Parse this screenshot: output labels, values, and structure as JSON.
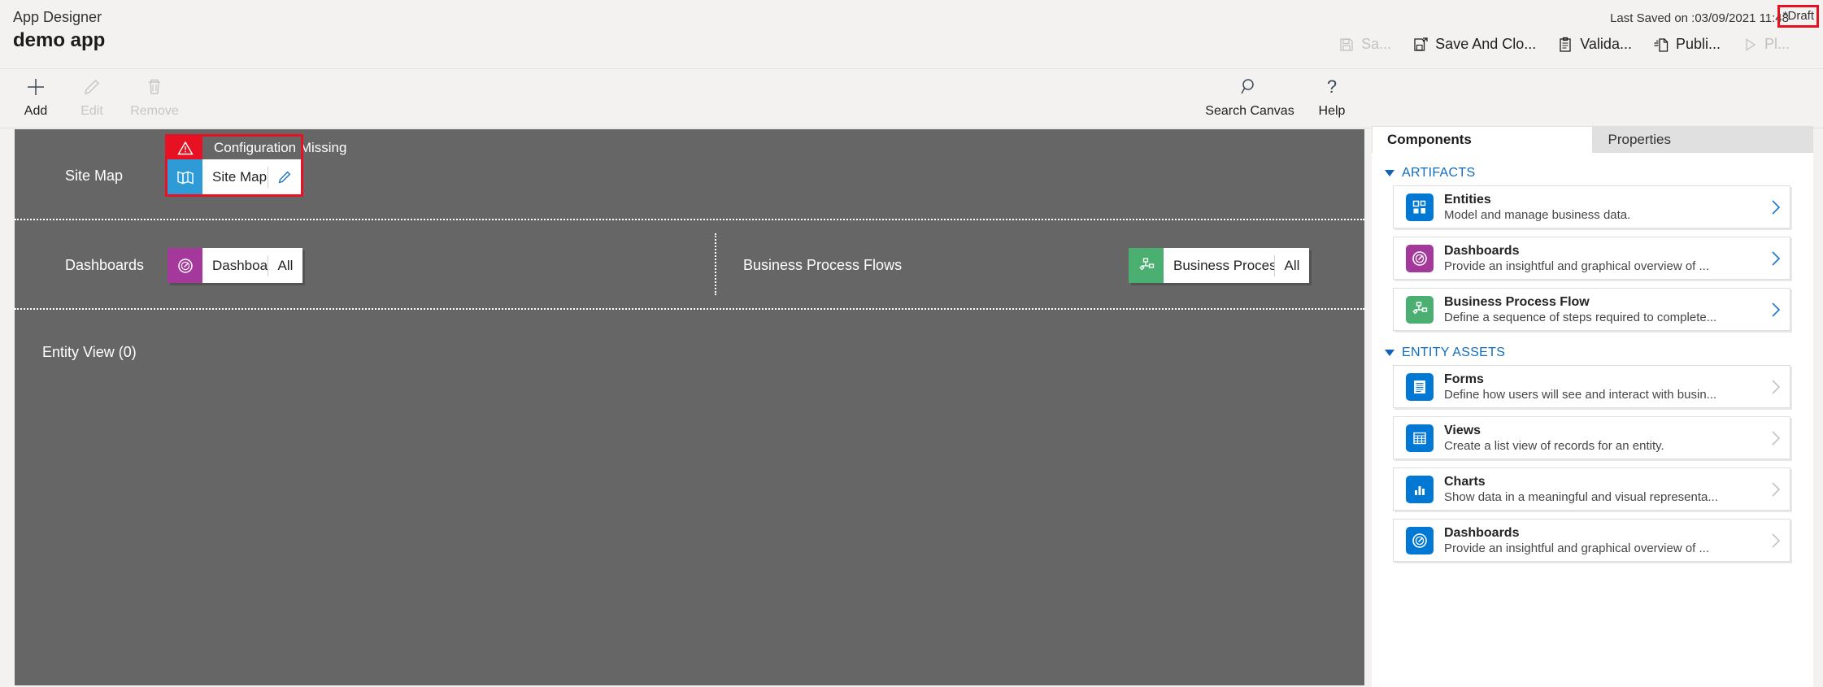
{
  "header": {
    "app_designer_label": "App Designer",
    "app_name": "demo app",
    "last_saved": "Last Saved on :03/09/2021 11:48",
    "draft_badge": "*Draft",
    "accent_red": "#e81123",
    "actions": [
      {
        "label": "Sa...",
        "icon": "save-icon",
        "disabled": true
      },
      {
        "label": "Save And Clo...",
        "icon": "save-and-close-icon",
        "disabled": false
      },
      {
        "label": "Valida...",
        "icon": "validate-clipboard-icon",
        "disabled": false
      },
      {
        "label": "Publi...",
        "icon": "publish-icon",
        "disabled": false
      },
      {
        "label": "Pl...",
        "icon": "play-icon",
        "disabled": true
      }
    ]
  },
  "commandbar": {
    "left": [
      {
        "label": "Add",
        "icon": "plus-icon",
        "disabled": false
      },
      {
        "label": "Edit",
        "icon": "pencil-icon",
        "disabled": true
      },
      {
        "label": "Remove",
        "icon": "trash-icon",
        "disabled": true
      }
    ],
    "right": [
      {
        "label": "Search Canvas",
        "icon": "search-icon",
        "disabled": false
      },
      {
        "label": "Help",
        "icon": "question-mark-icon",
        "disabled": false
      }
    ]
  },
  "canvas": {
    "rows": [
      {
        "label": "Site Map",
        "warning": {
          "text": "Configuration Missing",
          "icon": "warning-triangle-icon",
          "color": "#e81123"
        },
        "tiles": [
          {
            "name": "Site Map",
            "icon": "sitemap-book-icon",
            "icon_color": "#2e9bd6",
            "suffix": "",
            "has_edit": true,
            "highlighted": true
          }
        ]
      },
      {
        "label": "Dashboards",
        "tiles": [
          {
            "name": "Dashboards",
            "icon": "dashboard-gauge-icon",
            "icon_color": "#a4399b",
            "suffix": "All",
            "has_edit": false,
            "highlighted": false
          }
        ]
      },
      {
        "label": "Business Process Flows",
        "tiles": [
          {
            "name": "Business Proces...",
            "icon": "process-flow-icon",
            "icon_color": "#4caf72",
            "suffix": "All",
            "has_edit": false,
            "highlighted": false
          }
        ]
      },
      {
        "label": "Entity View (0)",
        "tiles": []
      }
    ]
  },
  "panel": {
    "tabs": [
      {
        "label": "Components",
        "active": true
      },
      {
        "label": "Properties",
        "active": false
      }
    ],
    "groups": [
      {
        "title": "ARTIFACTS",
        "cards": [
          {
            "title": "Entities",
            "desc": "Model and manage business data.",
            "icon": "entities-grid-icon",
            "color": "#0078d4",
            "chevron_enabled": true
          },
          {
            "title": "Dashboards",
            "desc": "Provide an insightful and graphical overview of ...",
            "icon": "dashboard-gauge-icon",
            "color": "#a4399b",
            "chevron_enabled": true
          },
          {
            "title": "Business Process Flow",
            "desc": "Define a sequence of steps required to complete...",
            "icon": "process-flow-icon",
            "color": "#4caf72",
            "chevron_enabled": true
          }
        ]
      },
      {
        "title": "ENTITY ASSETS",
        "cards": [
          {
            "title": "Forms",
            "desc": "Define how users will see and interact with busin...",
            "icon": "form-icon",
            "color": "#0078d4",
            "chevron_enabled": false
          },
          {
            "title": "Views",
            "desc": "Create a list view of records for an entity.",
            "icon": "views-table-icon",
            "color": "#0078d4",
            "chevron_enabled": false
          },
          {
            "title": "Charts",
            "desc": "Show data in a meaningful and visual representa...",
            "icon": "charts-bar-icon",
            "color": "#0078d4",
            "chevron_enabled": false
          },
          {
            "title": "Dashboards",
            "desc": "Provide an insightful and graphical overview of ...",
            "icon": "dashboard-gauge-icon",
            "color": "#0078d4",
            "chevron_enabled": false
          }
        ]
      }
    ]
  }
}
